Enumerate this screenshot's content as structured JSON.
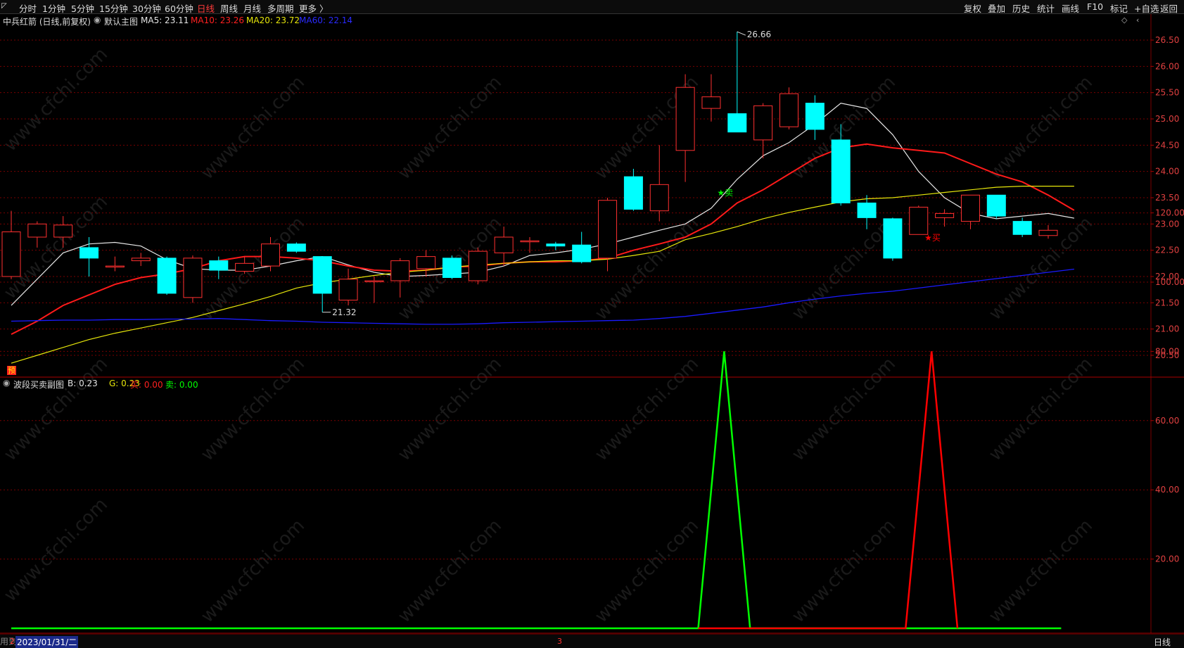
{
  "toolbar": {
    "periods": [
      "分时",
      "1分钟",
      "5分钟",
      "15分钟",
      "30分钟",
      "60分钟",
      "日线",
      "周线",
      "月线",
      "多周期",
      "更多 〉"
    ],
    "active_period": "日线",
    "right_items": [
      "复权",
      "叠加",
      "历史",
      "统计",
      "画线",
      "F10",
      "标记",
      "+自选",
      "返回"
    ]
  },
  "main_header": {
    "stock": "中兵红箭 (日线,前复权)",
    "indicator": "默认主图",
    "ma5": "MA5: 23.11",
    "ma10": "MA10: 23.26",
    "ma20": "MA20: 23.72",
    "ma60": "MA60: 22.14"
  },
  "sub_header": {
    "indicator": "波段买卖副图",
    "b": "B: 0.23",
    "g": "G: 0.23",
    "buy": "买: 0.00",
    "sell": "卖: 0.00"
  },
  "annotations": {
    "high": "26.66",
    "low": "21.32",
    "sell_signal": "★卖",
    "buy_signal": "★买",
    "pre_badge": "预"
  },
  "bottom": {
    "date": "2023/01/31/二",
    "mid_label": "3",
    "period": "日线",
    "left_text": "用到未来数据",
    "left_marker": "2"
  },
  "watermark": "www.cfchi.com",
  "colors": {
    "up": "#ff3030",
    "down": "#00ffff",
    "ma5": "#e6e6e6",
    "ma10": "#ff1a1a",
    "ma20": "#e6e60a",
    "ma60": "#1a1aff",
    "green": "#00ff00",
    "red": "#ff0000",
    "grid": "#7a0000"
  },
  "chart_data": [
    {
      "type": "candlestick",
      "title": "中兵红箭 (日线,前复权)",
      "ylim": [
        20.2,
        26.9
      ],
      "yticks": [
        "26.50",
        "26.00",
        "25.50",
        "25.00",
        "24.50",
        "24.00",
        "23.50",
        "23.00",
        "22.50",
        "22.00",
        "21.50",
        "21.00",
        "20.50"
      ],
      "candles": [
        {
          "o": 22.0,
          "h": 23.25,
          "l": 21.95,
          "c": 22.85
        },
        {
          "o": 22.75,
          "h": 23.05,
          "l": 22.55,
          "c": 23.0
        },
        {
          "o": 22.75,
          "h": 23.15,
          "l": 22.55,
          "c": 22.98
        },
        {
          "o": 22.55,
          "h": 22.75,
          "l": 22.0,
          "c": 22.35
        },
        {
          "o": 22.2,
          "h": 22.38,
          "l": 22.1,
          "c": 22.2
        },
        {
          "o": 22.3,
          "h": 22.45,
          "l": 22.2,
          "c": 22.35
        },
        {
          "o": 22.35,
          "h": 22.38,
          "l": 21.65,
          "c": 21.68
        },
        {
          "o": 21.6,
          "h": 22.4,
          "l": 21.5,
          "c": 22.35
        },
        {
          "o": 22.3,
          "h": 22.38,
          "l": 21.95,
          "c": 22.12
        },
        {
          "o": 22.1,
          "h": 22.38,
          "l": 22.05,
          "c": 22.25
        },
        {
          "o": 22.2,
          "h": 22.75,
          "l": 22.1,
          "c": 22.62
        },
        {
          "o": 22.62,
          "h": 22.65,
          "l": 22.45,
          "c": 22.48
        },
        {
          "o": 22.38,
          "h": 22.38,
          "l": 21.32,
          "c": 21.68
        },
        {
          "o": 21.55,
          "h": 22.15,
          "l": 21.45,
          "c": 21.95
        },
        {
          "o": 21.9,
          "h": 22.0,
          "l": 21.5,
          "c": 21.92
        },
        {
          "o": 21.92,
          "h": 22.35,
          "l": 21.6,
          "c": 22.3
        },
        {
          "o": 22.15,
          "h": 22.5,
          "l": 22.0,
          "c": 22.38
        },
        {
          "o": 22.35,
          "h": 22.4,
          "l": 21.95,
          "c": 21.98
        },
        {
          "o": 21.92,
          "h": 22.55,
          "l": 21.85,
          "c": 22.48
        },
        {
          "o": 22.45,
          "h": 22.95,
          "l": 22.2,
          "c": 22.75
        },
        {
          "o": 22.68,
          "h": 22.75,
          "l": 22.45,
          "c": 22.68
        },
        {
          "o": 22.62,
          "h": 22.66,
          "l": 22.5,
          "c": 22.58
        },
        {
          "o": 22.6,
          "h": 22.85,
          "l": 22.25,
          "c": 22.28
        },
        {
          "o": 22.35,
          "h": 23.5,
          "l": 22.1,
          "c": 23.45
        },
        {
          "o": 23.9,
          "h": 24.05,
          "l": 23.25,
          "c": 23.28
        },
        {
          "o": 23.25,
          "h": 24.5,
          "l": 23.05,
          "c": 23.75
        },
        {
          "o": 24.4,
          "h": 25.85,
          "l": 23.8,
          "c": 25.6
        },
        {
          "o": 25.2,
          "h": 25.85,
          "l": 24.95,
          "c": 25.42
        },
        {
          "o": 25.1,
          "h": 26.66,
          "l": 24.75,
          "c": 24.75
        },
        {
          "o": 24.6,
          "h": 25.3,
          "l": 24.25,
          "c": 25.25
        },
        {
          "o": 24.85,
          "h": 25.6,
          "l": 24.8,
          "c": 25.48
        },
        {
          "o": 25.3,
          "h": 25.45,
          "l": 24.6,
          "c": 24.8
        },
        {
          "o": 24.6,
          "h": 24.9,
          "l": 23.35,
          "c": 23.4
        },
        {
          "o": 23.4,
          "h": 23.55,
          "l": 22.9,
          "c": 23.12
        },
        {
          "o": 23.1,
          "h": 23.12,
          "l": 22.3,
          "c": 22.35
        },
        {
          "o": 22.8,
          "h": 23.35,
          "l": 22.8,
          "c": 23.32
        },
        {
          "o": 23.12,
          "h": 23.28,
          "l": 22.95,
          "c": 23.2
        },
        {
          "o": 23.05,
          "h": 23.55,
          "l": 22.9,
          "c": 23.55
        },
        {
          "o": 23.55,
          "h": 23.55,
          "l": 23.1,
          "c": 23.15
        },
        {
          "o": 23.05,
          "h": 23.12,
          "l": 22.75,
          "c": 22.8
        },
        {
          "o": 22.78,
          "h": 22.98,
          "l": 22.72,
          "c": 22.88
        }
      ],
      "series": [
        {
          "name": "MA5",
          "values": [
            21.45,
            21.95,
            22.45,
            22.62,
            22.65,
            22.58,
            22.32,
            22.15,
            22.12,
            22.12,
            22.2,
            22.3,
            22.38,
            22.22,
            22.08,
            22.0,
            22.02,
            22.05,
            22.08,
            22.2,
            22.4,
            22.45,
            22.52,
            22.62,
            22.75,
            22.88,
            23.0,
            23.3,
            23.85,
            24.3,
            24.55,
            24.9,
            25.3,
            25.2,
            24.7,
            24.0,
            23.5,
            23.2,
            23.1,
            23.15,
            23.2,
            23.11
          ]
        },
        {
          "name": "MA10",
          "values": [
            20.9,
            21.15,
            21.45,
            21.65,
            21.85,
            21.98,
            22.05,
            22.15,
            22.3,
            22.38,
            22.38,
            22.35,
            22.3,
            22.2,
            22.12,
            22.1,
            22.12,
            22.18,
            22.2,
            22.25,
            22.28,
            22.28,
            22.3,
            22.35,
            22.5,
            22.62,
            22.75,
            23.0,
            23.4,
            23.65,
            23.95,
            24.25,
            24.45,
            24.52,
            24.45,
            24.4,
            24.35,
            24.15,
            23.95,
            23.8,
            23.55,
            23.26
          ]
        },
        {
          "name": "MA20",
          "values": [
            20.35,
            20.5,
            20.65,
            20.8,
            20.92,
            21.02,
            21.12,
            21.22,
            21.35,
            21.48,
            21.62,
            21.78,
            21.88,
            21.95,
            22.02,
            22.08,
            22.12,
            22.18,
            22.22,
            22.25,
            22.28,
            22.3,
            22.3,
            22.33,
            22.4,
            22.48,
            22.7,
            22.82,
            22.95,
            23.1,
            23.22,
            23.32,
            23.42,
            23.48,
            23.5,
            23.55,
            23.6,
            23.65,
            23.7,
            23.72,
            23.72,
            23.72
          ]
        },
        {
          "name": "MA60",
          "values": [
            21.15,
            21.16,
            21.17,
            21.17,
            21.18,
            21.18,
            21.19,
            21.19,
            21.2,
            21.18,
            21.16,
            21.15,
            21.13,
            21.12,
            21.11,
            21.1,
            21.09,
            21.09,
            21.1,
            21.12,
            21.13,
            21.14,
            21.15,
            21.16,
            21.17,
            21.2,
            21.24,
            21.3,
            21.36,
            21.42,
            21.5,
            21.57,
            21.63,
            21.68,
            21.72,
            21.78,
            21.84,
            21.9,
            21.96,
            22.02,
            22.08,
            22.14
          ]
        }
      ],
      "high_label": 26.66,
      "low_label": 21.32
    },
    {
      "type": "line",
      "title": "波段买卖副图",
      "ylim": [
        0,
        135
      ],
      "yticks": [
        "120.00",
        "100.00",
        "80.00",
        "60.00",
        "40.00",
        "20.00"
      ],
      "series": [
        {
          "name": "G",
          "points": [
            [
              0,
              0
            ],
            [
              26.5,
              0
            ],
            [
              27.5,
              80
            ],
            [
              28.5,
              0
            ],
            [
              40.5,
              0
            ]
          ]
        },
        {
          "name": "B",
          "points": [
            [
              26.5,
              0
            ],
            [
              28.5,
              0
            ],
            [
              34.5,
              0
            ],
            [
              35.5,
              80
            ],
            [
              36.5,
              0
            ]
          ]
        }
      ],
      "signals": [
        {
          "label": "★卖",
          "index": 27.5,
          "value": 125
        },
        {
          "label": "★买",
          "index": 35.5,
          "value": 112
        }
      ]
    }
  ]
}
